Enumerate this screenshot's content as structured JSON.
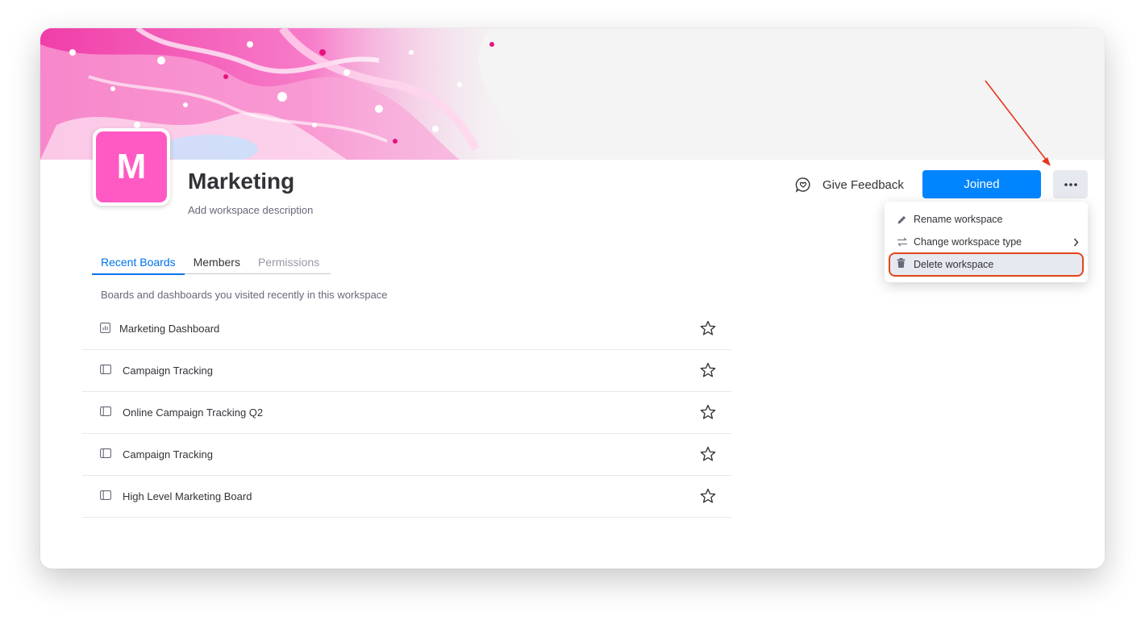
{
  "workspace": {
    "initial": "M",
    "title": "Marketing",
    "description": "Add workspace description",
    "logo_color": "#ff5ac4"
  },
  "header": {
    "feedback_label": "Give Feedback",
    "feedback_icon": "heart-chat-icon",
    "joined_label": "Joined",
    "more_icon": "more-horizontal-icon",
    "accent_color": "#0085ff"
  },
  "tabs": [
    {
      "label": "Recent Boards",
      "state": "active"
    },
    {
      "label": "Members",
      "state": "normal"
    },
    {
      "label": "Permissions",
      "state": "muted"
    }
  ],
  "recent": {
    "caption": "Boards and dashboards you visited recently in this workspace",
    "boards": [
      {
        "name": "Marketing Dashboard",
        "icon": "dashboard-icon"
      },
      {
        "name": "Campaign Tracking",
        "icon": "board-icon"
      },
      {
        "name": "Online Campaign Tracking Q2",
        "icon": "board-icon"
      },
      {
        "name": "Campaign Tracking",
        "icon": "board-icon"
      },
      {
        "name": "High Level Marketing Board",
        "icon": "board-icon"
      }
    ]
  },
  "menu": {
    "items": [
      {
        "label": "Rename workspace",
        "icon": "pencil-icon"
      },
      {
        "label": "Change workspace type",
        "icon": "switch-arrows-icon",
        "has_submenu": true
      },
      {
        "label": "Delete workspace",
        "icon": "trash-icon",
        "highlighted": true
      }
    ],
    "highlight_color": "#e2441c"
  }
}
